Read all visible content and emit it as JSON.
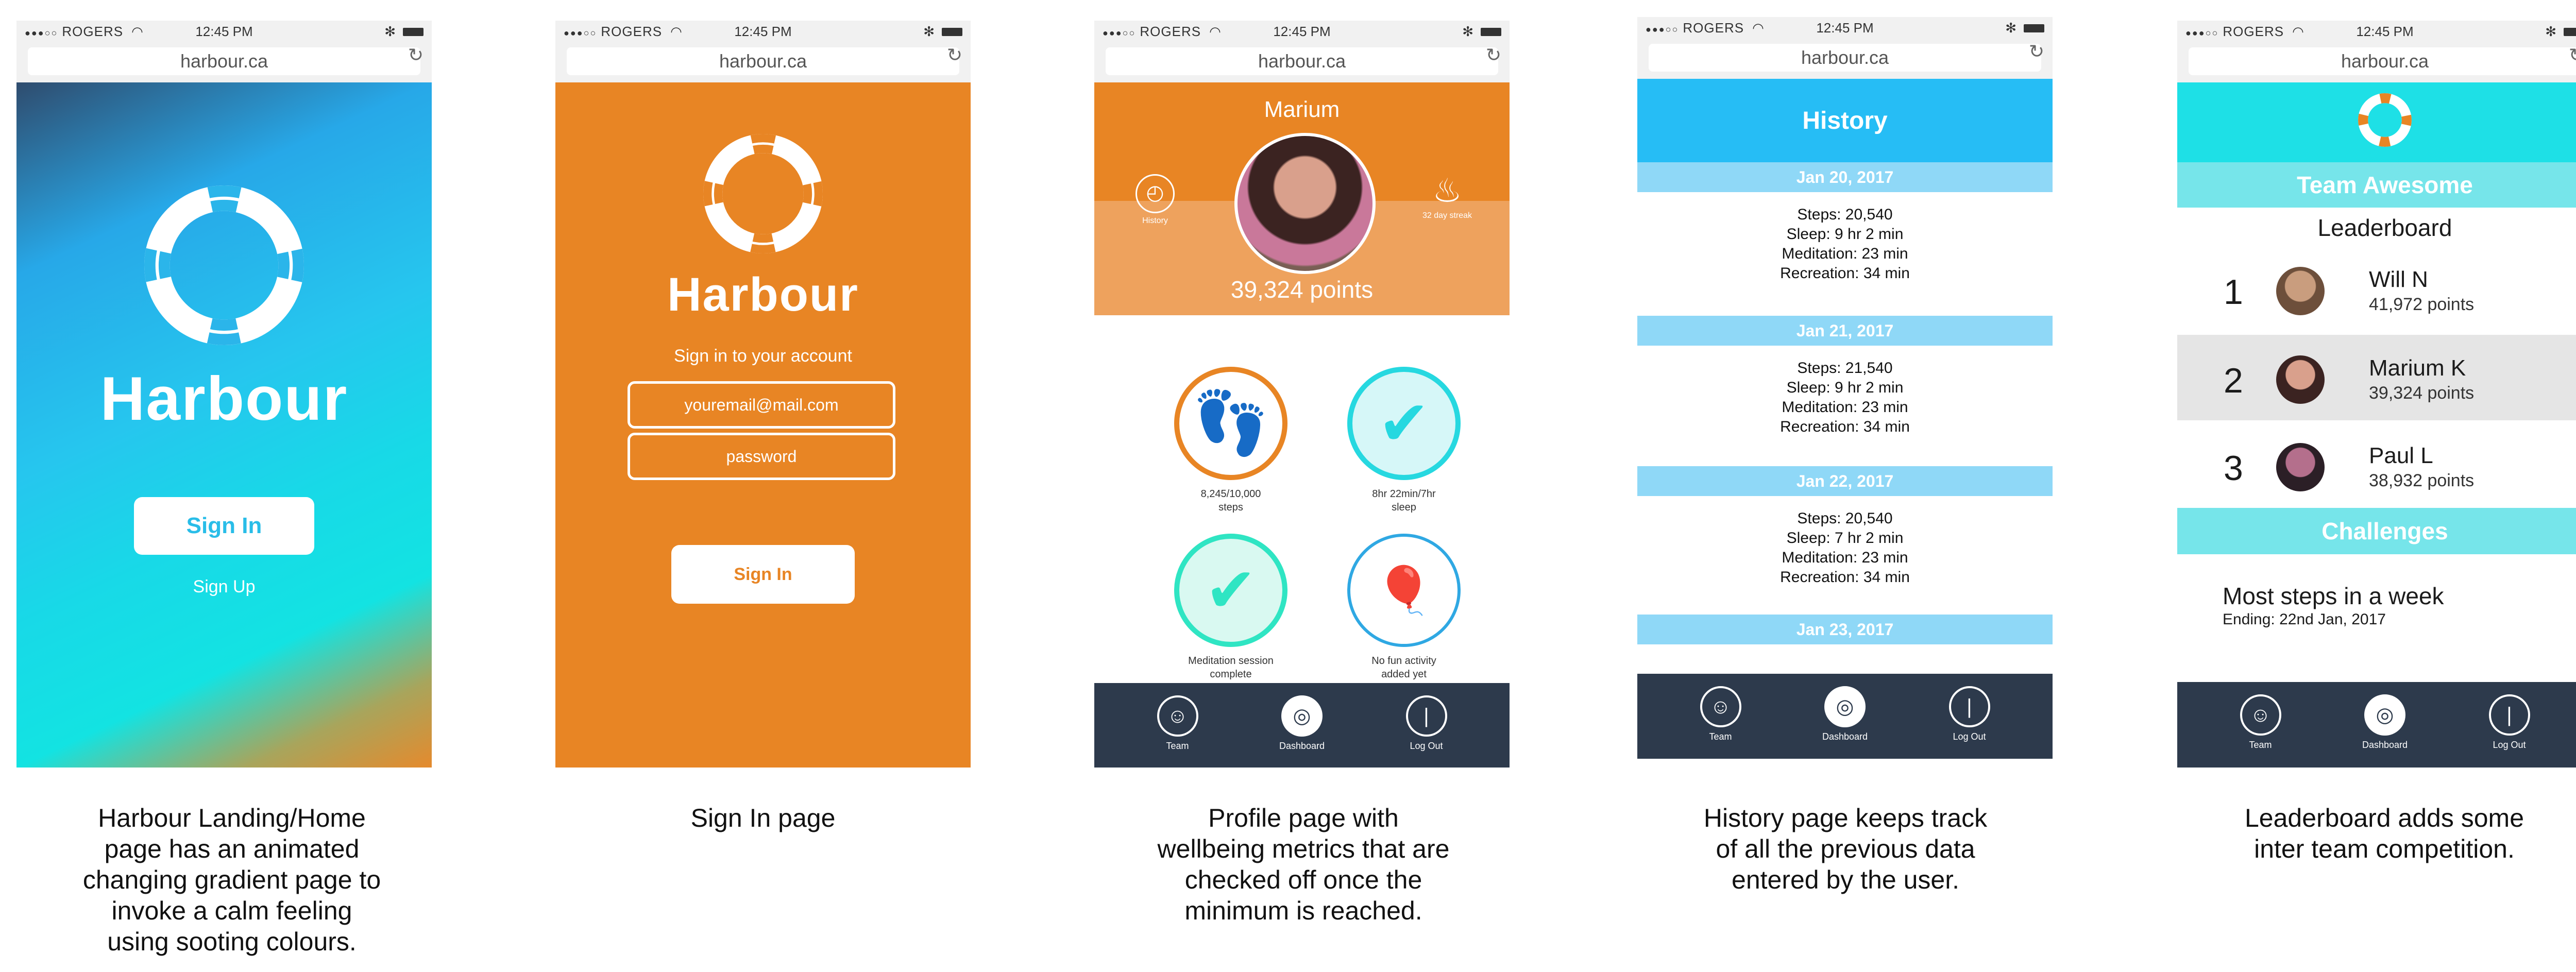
{
  "status": {
    "carrier": "ROGERS",
    "time": "12:45 PM"
  },
  "url": "harbour.ca",
  "landing": {
    "brand": "Harbour",
    "signin_label": "Sign In",
    "signup_label": "Sign Up"
  },
  "signin_page": {
    "brand": "Harbour",
    "prompt": "Sign in to your account",
    "email_placeholder": "youremail@mail.com",
    "password_placeholder": "password",
    "signin_label": "Sign In"
  },
  "profile": {
    "name": "Marium",
    "points": "39,324 points",
    "history_label": "History",
    "streak_label": "32 day streak",
    "metrics": [
      {
        "line1": "8,245/10,000",
        "line2": "steps",
        "icon": "footprints-icon",
        "color": "#e88524"
      },
      {
        "line1": "8hr 22min/7hr",
        "line2": "sleep",
        "icon": "check-icon",
        "color": "#26d8e0"
      },
      {
        "line1": "Meditation session",
        "line2": "complete",
        "icon": "check-icon",
        "color": "#2fe5c3"
      },
      {
        "line1": "No fun activity",
        "line2": "added yet",
        "icon": "balloon-icon",
        "color": "#2fa8e3"
      }
    ]
  },
  "nav": {
    "team": "Team",
    "dashboard": "Dashboard",
    "logout": "Log Out"
  },
  "history": {
    "title": "History",
    "entries": [
      {
        "date": "Jan 20, 2017",
        "steps": "Steps: 20,540",
        "sleep": "Sleep: 9 hr 2 min",
        "meditation": "Meditation: 23 min",
        "recreation": "Recreation: 34 min"
      },
      {
        "date": "Jan 21, 2017",
        "steps": "Steps: 21,540",
        "sleep": "Sleep: 9 hr 2 min",
        "meditation": "Meditation: 23 min",
        "recreation": "Recreation: 34 min"
      },
      {
        "date": "Jan 22, 2017",
        "steps": "Steps: 20,540",
        "sleep": "Sleep: 7 hr 2 min",
        "meditation": "Meditation: 23 min",
        "recreation": "Recreation: 34 min"
      },
      {
        "date": "Jan 23, 2017"
      }
    ]
  },
  "leaderboard": {
    "team_name": "Team Awesome",
    "title": "Leaderboard",
    "rows": [
      {
        "rank": "1",
        "name": "Will N",
        "points": "41,972 points"
      },
      {
        "rank": "2",
        "name": "Marium K",
        "points": "39,324 points"
      },
      {
        "rank": "3",
        "name": "Paul L",
        "points": "38,932 points"
      }
    ],
    "challenges_title": "Challenges",
    "challenge_name": "Most steps in a week",
    "challenge_ending": "Ending: 22nd Jan, 2017"
  },
  "captions": [
    [
      "Harbour Landing/Home",
      "page has an animated",
      "changing gradient page to",
      "invoke a calm feeling",
      "using sooting colours."
    ],
    [
      "Sign In page"
    ],
    [
      "Profile page with",
      "wellbeing metrics that are",
      "checked off once the",
      "minimum is reached."
    ],
    [
      "History page keeps track",
      "of all the previous data",
      "entered by the user."
    ],
    [
      "Leaderboard adds some",
      "inter team competition."
    ]
  ]
}
